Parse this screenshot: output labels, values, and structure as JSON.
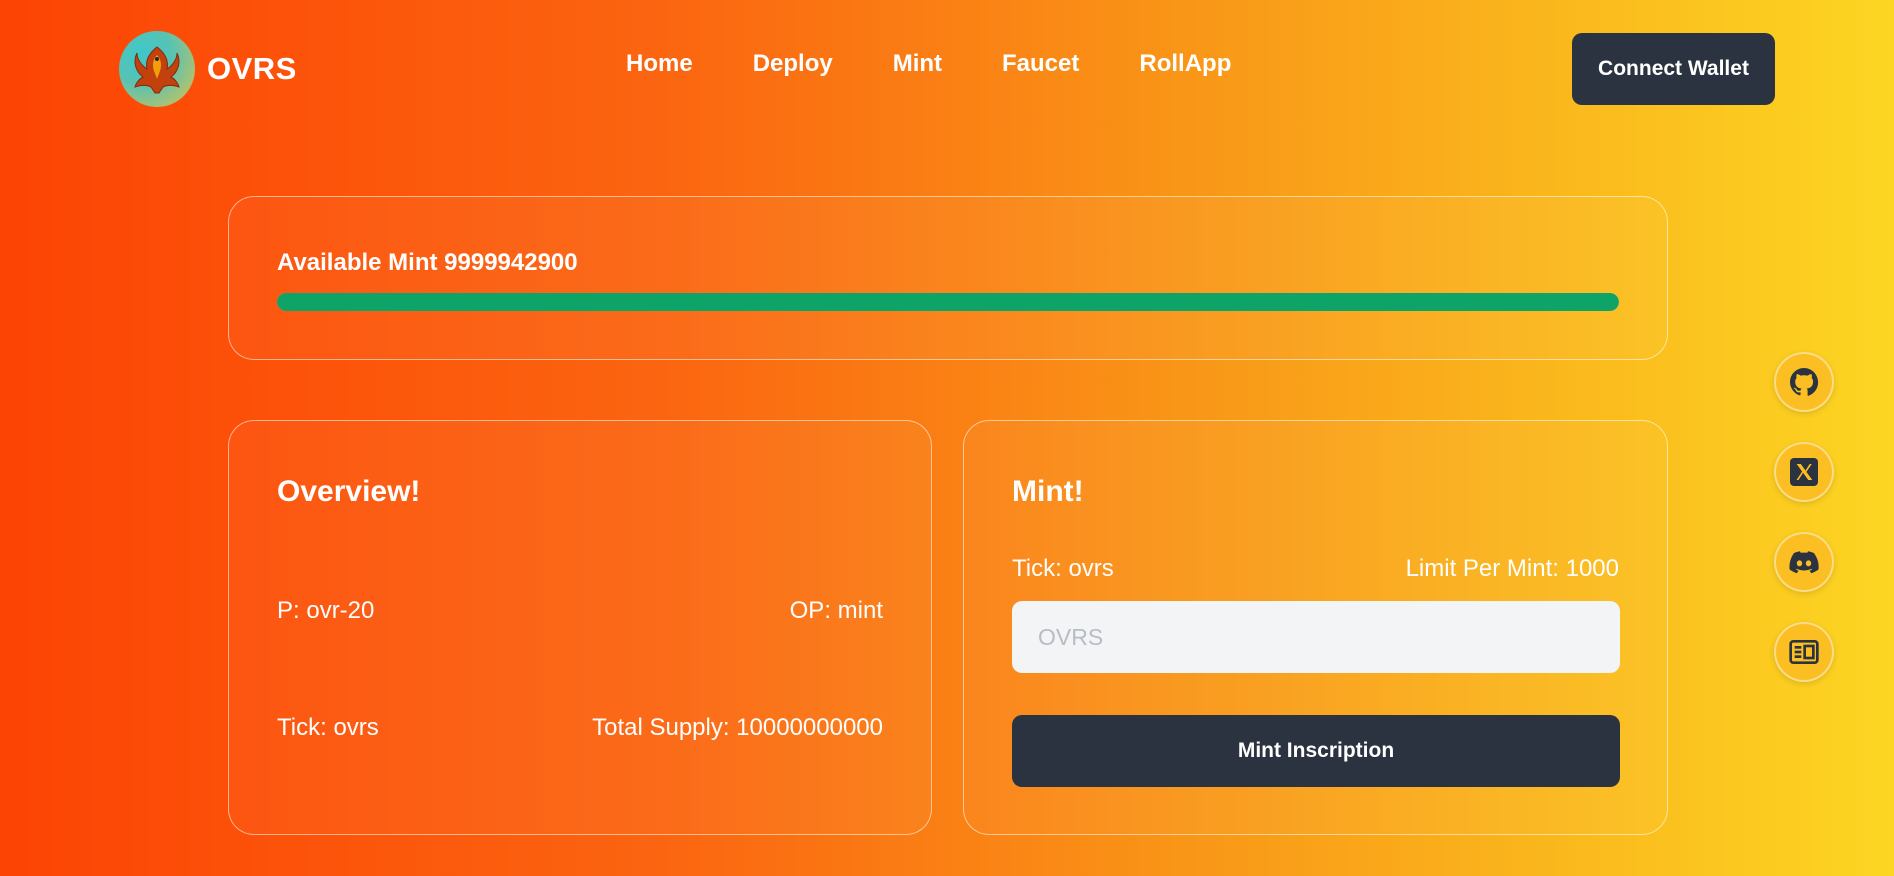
{
  "header": {
    "brand": "OVRS",
    "nav": [
      "Home",
      "Deploy",
      "Mint",
      "Faucet",
      "RollApp"
    ],
    "connect_label": "Connect Wallet"
  },
  "available": {
    "label": "Available Mint 9999942900",
    "progress_percent": 99.9994
  },
  "overview": {
    "title": "Overview!",
    "p": "P: ovr-20",
    "op": "OP: mint",
    "tick": "Tick: ovrs",
    "total_supply": "Total Supply: 10000000000"
  },
  "mint": {
    "title": "Mint!",
    "tick": "Tick: ovrs",
    "limit": "Limit Per Mint: 1000",
    "input_placeholder": "OVRS",
    "button_label": "Mint Inscription"
  },
  "social": [
    "github-icon",
    "x-icon",
    "discord-icon",
    "docs-icon"
  ],
  "colors": {
    "accent_dark": "#2c3340",
    "progress": "#0ea468",
    "social_bg": "#fbbf24"
  }
}
